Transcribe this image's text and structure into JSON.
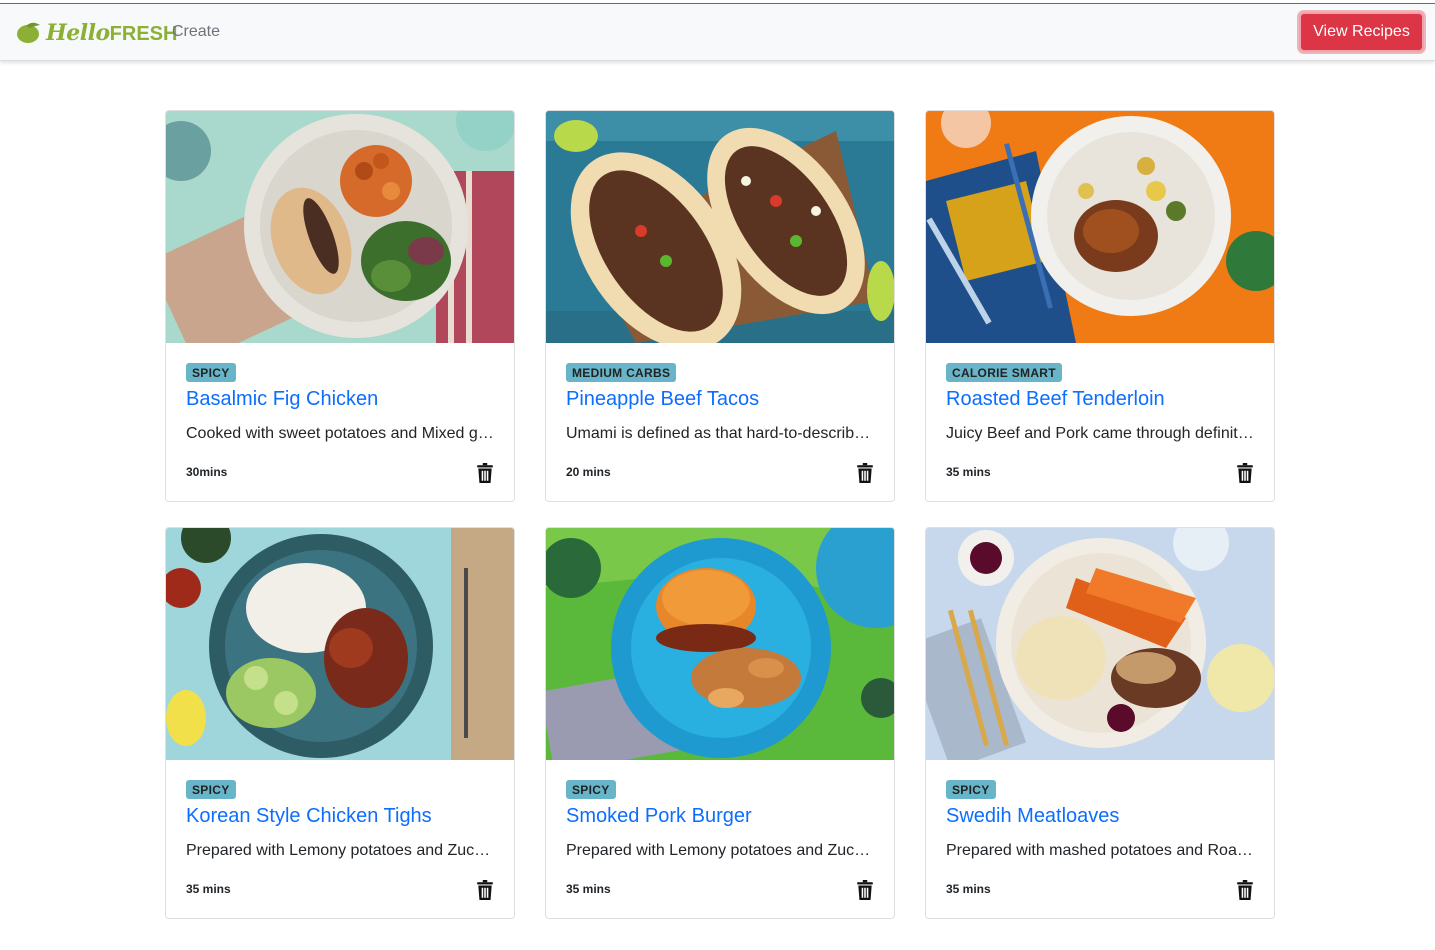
{
  "navbar": {
    "brand_hello": "Hello",
    "brand_fresh": "FRESH",
    "create_link": "Create",
    "view_recipes_button": "View Recipes"
  },
  "colors": {
    "accent": "#0d6efd",
    "danger": "#dc3545",
    "badge": "#68b5c9",
    "brand": "#8cb035"
  },
  "recipes": [
    {
      "tag": "SPICY",
      "title": "Basalmic Fig Chicken",
      "description": "Cooked with sweet potatoes and Mixed greens",
      "time": "30mins",
      "image_icon": "plate-chicken-sweet-potatoes-image"
    },
    {
      "tag": "MEDIUM CARBS",
      "title": "Pineapple Beef Tacos",
      "description": "Umami is defined as that hard-to-describe savory flavor",
      "time": "20 mins",
      "image_icon": "beef-tacos-image"
    },
    {
      "tag": "CALORIE SMART",
      "title": "Roasted Beef Tenderloin",
      "description": "Juicy Beef and Pork came through definitely",
      "time": "35 mins",
      "image_icon": "beef-tenderloin-plate-image"
    },
    {
      "tag": "SPICY",
      "title": "Korean Style Chicken Tighs",
      "description": "Prepared with Lemony potatoes and Zucchini",
      "time": "35 mins",
      "image_icon": "korean-chicken-bowl-image"
    },
    {
      "tag": "SPICY",
      "title": "Smoked Pork Burger",
      "description": "Prepared with Lemony potatoes and Zucchini",
      "time": "35 mins",
      "image_icon": "pork-burger-plate-image"
    },
    {
      "tag": "SPICY",
      "title": "Swedih Meatloaves",
      "description": "Prepared with mashed potatoes and Roasted carrots",
      "time": "35 mins",
      "image_icon": "meatloaves-plate-image"
    }
  ]
}
